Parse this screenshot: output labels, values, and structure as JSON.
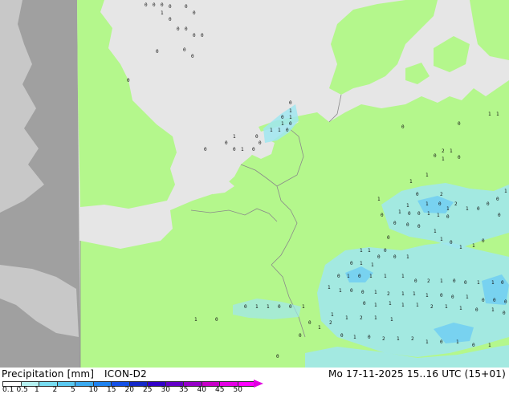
{
  "title": "Precipitation [mm]",
  "model": "ICON-D2",
  "valid_time": "Mo 17-11-2025 15..16 UTC (15+01)",
  "legend": {
    "ticks": [
      "0.1",
      "0.5",
      "1",
      "2",
      "5",
      "10",
      "15",
      "20",
      "25",
      "30",
      "35",
      "40",
      "45",
      "50"
    ],
    "colors": [
      "#ffffff",
      "#b4f0f0",
      "#78dcf0",
      "#5ac8f0",
      "#3caaf0",
      "#1e82f0",
      "#1450e6",
      "#1428c8",
      "#3200c8",
      "#6400c8",
      "#9600c8",
      "#c800c8",
      "#e600e6",
      "#ff00ff"
    ]
  },
  "colors": {
    "sea": "#e6e6e6",
    "land_domain": "#b4f78c",
    "land_outside": "#c8c8c8",
    "outside_domain": "#a0a0a0",
    "rain_light": "#a0e6f0",
    "rain_moderate": "#78d2f0",
    "border_line": "#8a8a8a"
  },
  "precip_values": [
    {
      "text": "0"
    },
    {
      "text": "0"
    },
    {
      "text": "0"
    },
    {
      "text": "0"
    },
    {
      "text": "0"
    },
    {
      "text": "0"
    },
    {
      "text": "1"
    },
    {
      "text": "0"
    },
    {
      "text": "0"
    },
    {
      "text": "0"
    },
    {
      "text": "0"
    },
    {
      "text": "0"
    },
    {
      "text": "0"
    },
    {
      "text": "0"
    },
    {
      "text": "0"
    },
    {
      "text": "0"
    },
    {
      "text": "0"
    },
    {
      "text": "1"
    },
    {
      "text": "0"
    },
    {
      "text": "1"
    },
    {
      "text": "1"
    },
    {
      "text": "0"
    },
    {
      "text": "1"
    },
    {
      "text": "0"
    },
    {
      "text": "0"
    },
    {
      "text": "1"
    },
    {
      "text": "0"
    },
    {
      "text": "0"
    },
    {
      "text": "1"
    },
    {
      "text": "1"
    },
    {
      "text": "0"
    },
    {
      "text": "0"
    },
    {
      "text": "0"
    },
    {
      "text": "0"
    },
    {
      "text": "2"
    },
    {
      "text": "1"
    },
    {
      "text": "0"
    },
    {
      "text": "1"
    },
    {
      "text": "0"
    },
    {
      "text": "1"
    },
    {
      "text": "1"
    },
    {
      "text": "0"
    },
    {
      "text": "1"
    },
    {
      "text": "1"
    },
    {
      "text": "2"
    },
    {
      "text": "0"
    },
    {
      "text": "1"
    },
    {
      "text": "1"
    },
    {
      "text": "0"
    },
    {
      "text": "1"
    },
    {
      "text": "2"
    },
    {
      "text": "1"
    },
    {
      "text": "0"
    },
    {
      "text": "0"
    },
    {
      "text": "1"
    },
    {
      "text": "1"
    },
    {
      "text": "0"
    },
    {
      "text": "1"
    },
    {
      "text": "0"
    },
    {
      "text": "0"
    },
    {
      "text": "0"
    },
    {
      "text": "1"
    },
    {
      "text": "0"
    },
    {
      "text": "1"
    },
    {
      "text": "0"
    },
    {
      "text": "0"
    },
    {
      "text": "0"
    },
    {
      "text": "0"
    },
    {
      "text": "1"
    },
    {
      "text": "1"
    },
    {
      "text": "0"
    },
    {
      "text": "1"
    },
    {
      "text": "1"
    },
    {
      "text": "0"
    },
    {
      "text": "0"
    },
    {
      "text": "0"
    },
    {
      "text": "1"
    },
    {
      "text": "1"
    },
    {
      "text": "0"
    },
    {
      "text": "1"
    },
    {
      "text": "1"
    },
    {
      "text": "0"
    },
    {
      "text": "0"
    },
    {
      "text": "1"
    },
    {
      "text": "0"
    },
    {
      "text": "1"
    },
    {
      "text": "0"
    },
    {
      "text": "1"
    },
    {
      "text": "1"
    },
    {
      "text": "1"
    },
    {
      "text": "0"
    },
    {
      "text": "2"
    },
    {
      "text": "1"
    },
    {
      "text": "0"
    },
    {
      "text": "0"
    },
    {
      "text": "1"
    },
    {
      "text": "1"
    },
    {
      "text": "0"
    },
    {
      "text": "1"
    },
    {
      "text": "1"
    },
    {
      "text": "0"
    },
    {
      "text": "0"
    },
    {
      "text": "1"
    },
    {
      "text": "2"
    },
    {
      "text": "1"
    },
    {
      "text": "1"
    },
    {
      "text": "1"
    },
    {
      "text": "0"
    },
    {
      "text": "0"
    },
    {
      "text": "1"
    },
    {
      "text": "0"
    },
    {
      "text": "0"
    },
    {
      "text": "0"
    },
    {
      "text": "0"
    },
    {
      "text": "1"
    },
    {
      "text": "1"
    },
    {
      "text": "1"
    },
    {
      "text": "1"
    },
    {
      "text": "2"
    },
    {
      "text": "1"
    },
    {
      "text": "1"
    },
    {
      "text": "0"
    },
    {
      "text": "1"
    },
    {
      "text": "0"
    },
    {
      "text": "1"
    },
    {
      "text": "1"
    },
    {
      "text": "2"
    },
    {
      "text": "1"
    },
    {
      "text": "1"
    },
    {
      "text": "0"
    },
    {
      "text": "1"
    },
    {
      "text": "1"
    },
    {
      "text": "0"
    },
    {
      "text": "0"
    },
    {
      "text": "1"
    },
    {
      "text": "1"
    },
    {
      "text": "0"
    },
    {
      "text": "0"
    },
    {
      "text": "2"
    },
    {
      "text": "1"
    },
    {
      "text": "0"
    },
    {
      "text": "0"
    },
    {
      "text": "1"
    },
    {
      "text": "0"
    },
    {
      "text": "2"
    },
    {
      "text": "1"
    },
    {
      "text": "2"
    },
    {
      "text": "1"
    },
    {
      "text": "0"
    },
    {
      "text": "1"
    },
    {
      "text": "0"
    },
    {
      "text": "1"
    },
    {
      "text": "0"
    },
    {
      "text": "0"
    },
    {
      "text": "1"
    },
    {
      "text": "1"
    },
    {
      "text": "1"
    },
    {
      "text": "2"
    },
    {
      "text": "0"
    },
    {
      "text": "0"
    },
    {
      "text": "1"
    },
    {
      "text": "1"
    },
    {
      "text": "0"
    },
    {
      "text": "0"
    },
    {
      "text": "0"
    }
  ]
}
